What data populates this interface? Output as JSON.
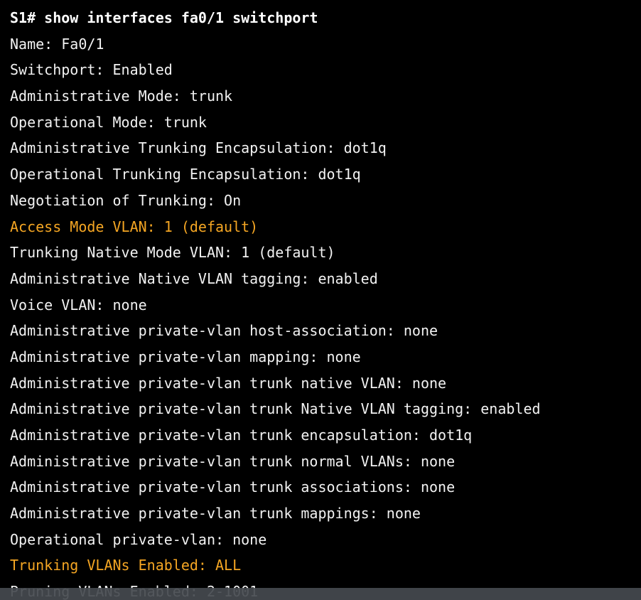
{
  "terminal": {
    "prompt": "S1#",
    "command": "show interfaces fa0/1 switchport",
    "highlight_color": "#f5a623",
    "text_color": "#f2f2f2",
    "background_color": "#000000",
    "lines": [
      {
        "text": "Name: Fa0/1",
        "highlight": false
      },
      {
        "text": "Switchport: Enabled",
        "highlight": false
      },
      {
        "text": "Administrative Mode: trunk",
        "highlight": false
      },
      {
        "text": "Operational Mode: trunk",
        "highlight": false
      },
      {
        "text": "Administrative Trunking Encapsulation: dot1q",
        "highlight": false
      },
      {
        "text": "Operational Trunking Encapsulation: dot1q",
        "highlight": false
      },
      {
        "text": "Negotiation of Trunking: On",
        "highlight": false
      },
      {
        "text": "Access Mode VLAN: 1 (default)",
        "highlight": true
      },
      {
        "text": "Trunking Native Mode VLAN: 1 (default)",
        "highlight": false
      },
      {
        "text": "Administrative Native VLAN tagging: enabled",
        "highlight": false
      },
      {
        "text": "Voice VLAN: none",
        "highlight": false
      },
      {
        "text": "Administrative private-vlan host-association: none",
        "highlight": false
      },
      {
        "text": "Administrative private-vlan mapping: none",
        "highlight": false
      },
      {
        "text": "Administrative private-vlan trunk native VLAN: none",
        "highlight": false
      },
      {
        "text": "Administrative private-vlan trunk Native VLAN tagging: enabled",
        "highlight": false
      },
      {
        "text": "Administrative private-vlan trunk encapsulation: dot1q",
        "highlight": false
      },
      {
        "text": "Administrative private-vlan trunk normal VLANs: none",
        "highlight": false
      },
      {
        "text": "Administrative private-vlan trunk associations: none",
        "highlight": false
      },
      {
        "text": "Administrative private-vlan trunk mappings: none",
        "highlight": false
      },
      {
        "text": "Operational private-vlan: none",
        "highlight": false
      },
      {
        "text": "Trunking VLANs Enabled: ALL",
        "highlight": true
      },
      {
        "text": "Pruning VLANs Enabled: 2-1001",
        "highlight": false
      }
    ]
  }
}
